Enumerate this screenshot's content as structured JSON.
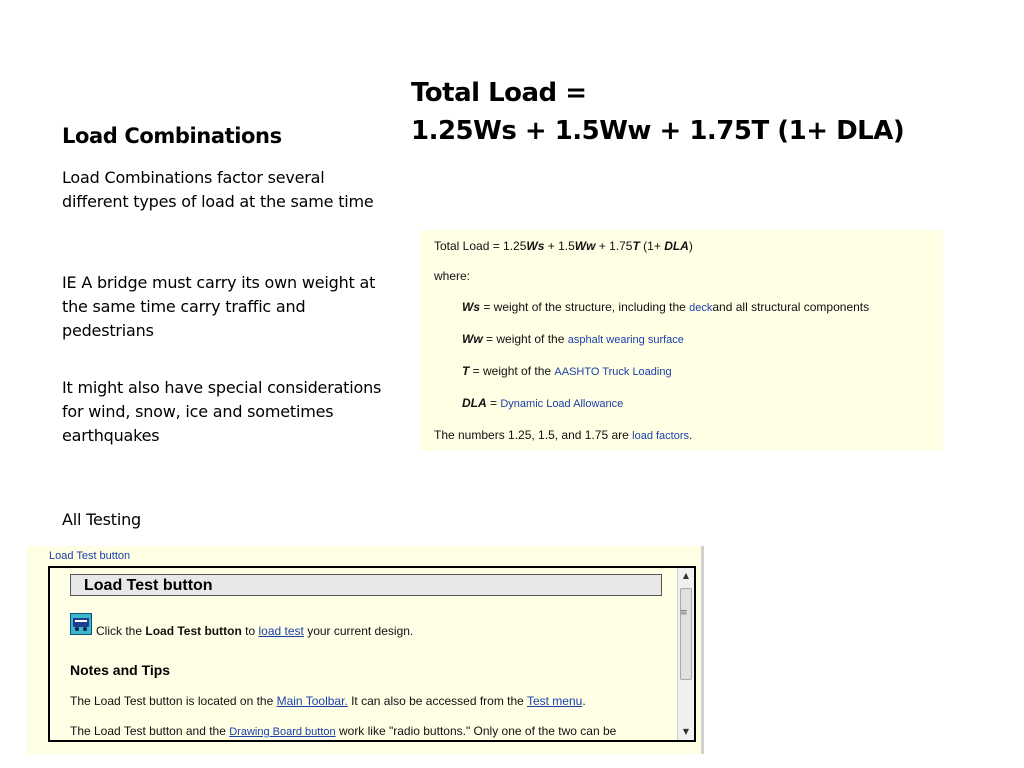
{
  "heading": {
    "line1": "Total Load =",
    "line2": "1.25Ws + 1.5Ww + 1.75T (1+ DLA)"
  },
  "left": {
    "title": "Load Combinations",
    "para1": "Load Combinations factor several different types of load at the same time",
    "para2": "IE A bridge must carry its own weight at the same time carry traffic and pedestrians",
    "para3": "It might also have special considerations for wind, snow, ice and sometimes earthquakes",
    "all_testing": "All Testing"
  },
  "definition_panel": {
    "formula_prefix": "Total Load = 1.25",
    "ws": "Ws",
    "plus1": " + 1.5",
    "ww": "Ww",
    "plus2": " + 1.75",
    "t": "T",
    "paren_open": " (1+ ",
    "dla": "DLA",
    "paren_close": ")",
    "where": "where:",
    "ws_def_sym": "Ws",
    "ws_def_text": " = weight of the structure, including the ",
    "ws_def_link": "deck",
    "ws_def_end": "and all structural components",
    "ww_def_sym": "Ww",
    "ww_def_text": " = weight of the ",
    "ww_def_link": "asphalt  wearing surface",
    "t_def_sym": "T",
    "t_def_text": " = weight of the ",
    "t_def_link": "AASHTO Truck Loading",
    "dla_def_sym": "DLA",
    "dla_def_text": " = ",
    "dla_def_link": "Dynamic Load Allowance",
    "numbers_text": "The numbers 1.25, 1.5, and 1.75 are ",
    "numbers_link": "load factors",
    "numbers_end": "."
  },
  "help_window": {
    "caption": "Load Test button",
    "title": "Load Test button",
    "click_text": "Click the ",
    "click_bold": "Load Test button",
    "click_to": " to ",
    "click_link": "load test",
    "click_end": " your current design.",
    "notes_title": "Notes and Tips",
    "tip1_text": "The Load Test button is located on the ",
    "tip1_link1": "Main Toolbar.",
    "tip1_mid": " It can also be accessed from the ",
    "tip1_link2": "Test menu",
    "tip1_end": ".",
    "tip2_text": "The Load Test button and the ",
    "tip2_link": "Drawing Board button",
    "tip2_end": " work like \"radio buttons.\" Only one of the two can be",
    "scroll_up": "▲",
    "scroll_down": "▼",
    "scroll_grip": "≡"
  },
  "colors": {
    "panel_background": "#ffffe6",
    "link": "#1a3fa8"
  }
}
